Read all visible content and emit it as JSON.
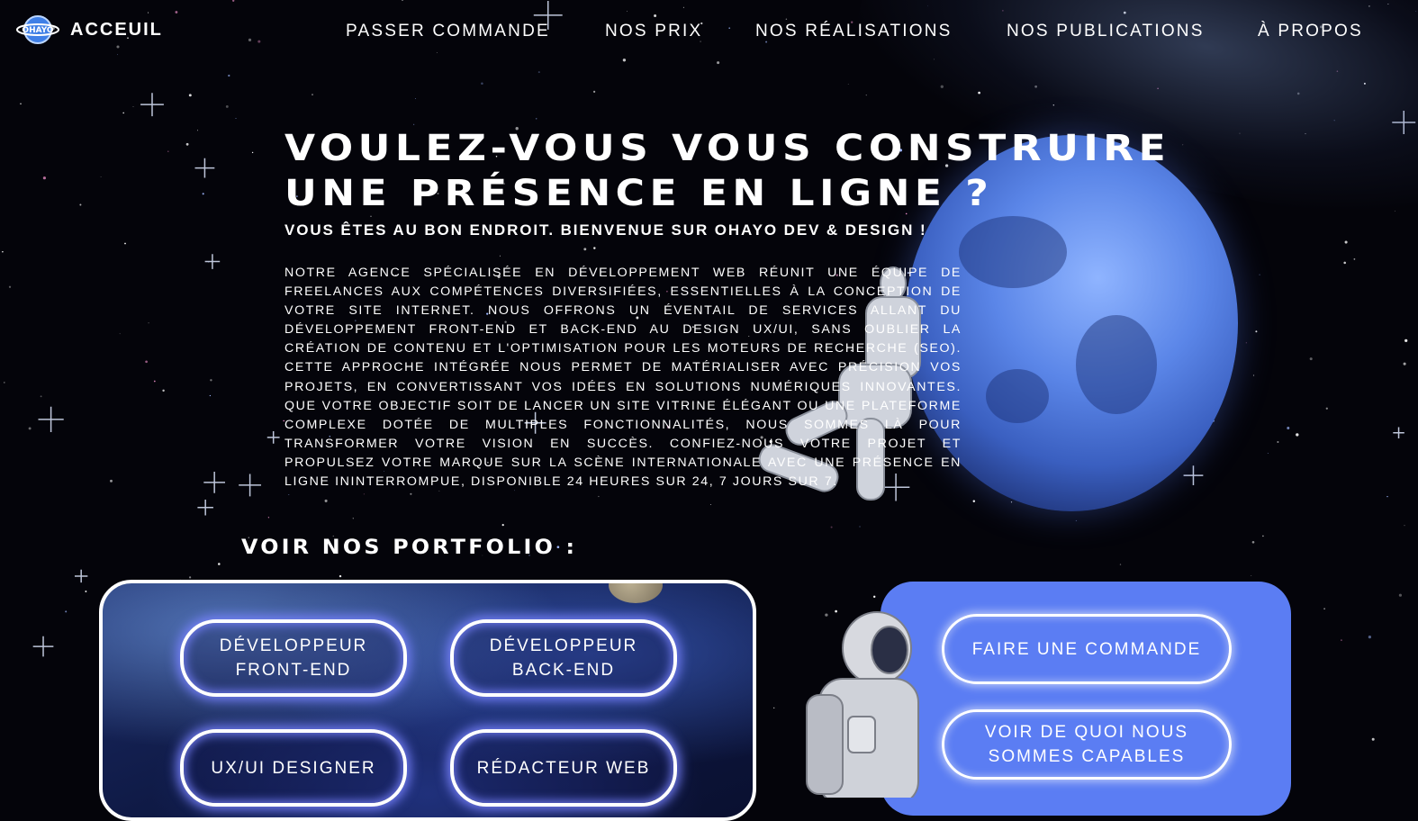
{
  "header": {
    "brand": "ACCEUIL",
    "logo_text": "OHAYO",
    "nav": [
      "PASSER COMMANDE",
      "NOS PRIX",
      "NOS RÉALISATIONS",
      "NOS PUBLICATIONS",
      "À PROPOS"
    ]
  },
  "hero": {
    "title_line1": "VOULEZ-VOUS VOUS CONSTRUIRE",
    "title_line2": "UNE PRÉSENCE EN LIGNE ?",
    "subtitle": "VOUS ÊTES AU BON ENDROIT. BIENVENUE SUR OHAYO DEV & DESIGN !",
    "body": "NOTRE AGENCE SPÉCIALISÉE EN DÉVELOPPEMENT WEB RÉUNIT UNE ÉQUIPE DE FREELANCES AUX COMPÉTENCES DIVERSIFIÉES, ESSENTIELLES À LA CONCEPTION DE VOTRE SITE INTERNET. NOUS OFFRONS UN ÉVENTAIL DE SERVICES ALLANT DU DÉVELOPPEMENT FRONT-END ET BACK-END AU DESIGN UX/UI, SANS OUBLIER LA CRÉATION DE CONTENU ET L'OPTIMISATION POUR LES MOTEURS DE RECHERCHE (SEO). CETTE APPROCHE INTÉGRÉE NOUS PERMET DE MATÉRIALISER AVEC PRÉCISION VOS PROJETS, EN CONVERTISSANT VOS IDÉES EN SOLUTIONS NUMÉRIQUES INNOVANTES. QUE VOTRE OBJECTIF SOIT DE LANCER UN SITE VITRINE ÉLÉGANT OU UNE PLATEFORME COMPLEXE DOTÉE DE MULTIPLES FONCTIONNALITÉS, NOUS SOMMES LÀ POUR TRANSFORMER VOTRE VISION EN SUCCÈS. CONFIEZ-NOUS VOTRE PROJET ET PROPULSEZ VOTRE MARQUE SUR LA SCÈNE INTERNATIONALE AVEC UNE PRÉSENCE EN LIGNE ININTERROMPUE, DISPONIBLE 24 HEURES SUR 24, 7 JOURS SUR 7."
  },
  "portfolio": {
    "title": "VOIR NOS PORTFOLIO :",
    "buttons": {
      "frontend_line1": "DÉVELOPPEUR",
      "frontend_line2": "FRONT-END",
      "backend_line1": "DÉVELOPPEUR",
      "backend_line2": "BACK-END",
      "uxui": "UX/UI DESIGNER",
      "redacteur": "RÉDACTEUR WEB"
    }
  },
  "cta": {
    "order": "FAIRE UNE COMMANDE",
    "capable_line1": "VOIR DE QUOI NOUS",
    "capable_line2": "SOMMES CAPABLES"
  },
  "colors": {
    "background": "#04040a",
    "planet": "#5b86e8",
    "cta_card": "#5b7df3",
    "glow": "#7880ff"
  }
}
